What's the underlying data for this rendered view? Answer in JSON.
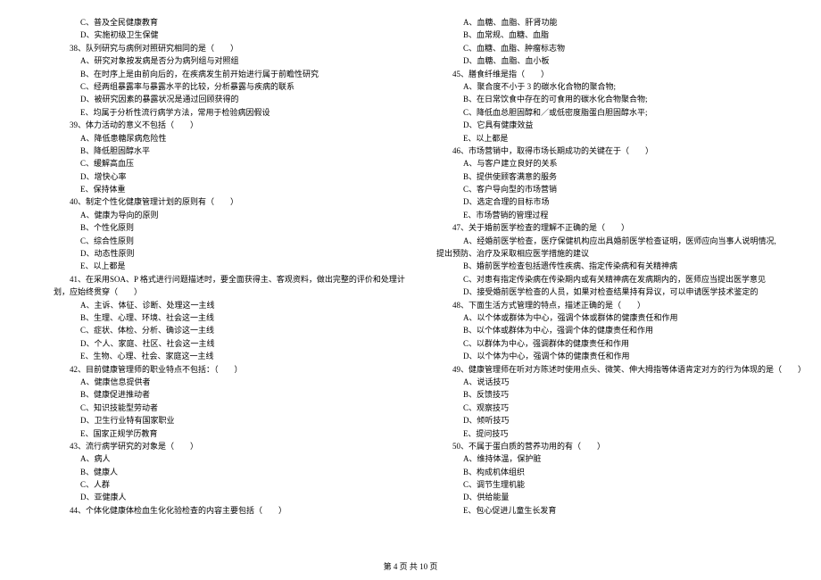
{
  "left": [
    {
      "cls": "indent1",
      "t": "C、普及全民健康教育"
    },
    {
      "cls": "indent1",
      "t": "D、实施初级卫生保健"
    },
    {
      "cls": "q",
      "t": "38、队列研究与病例对照研究相同的是（　　）"
    },
    {
      "cls": "indent1",
      "t": "A、研究对象按发病是否分为病列组与对照组"
    },
    {
      "cls": "indent1",
      "t": "B、在时序上是由前向后的，在疾病发生前开始进行属于前瞻性研究"
    },
    {
      "cls": "indent1",
      "t": "C、经两组暴露率与暴露水平的比较，分析暴露与疾病的联系"
    },
    {
      "cls": "indent1",
      "t": "D、被研究因素的暴露状况是通过回顾获得的"
    },
    {
      "cls": "indent1",
      "t": "E、均属于分析性流行病学方法，常用于检验病因假设"
    },
    {
      "cls": "q",
      "t": "39、体力活动的意义不包括（　　）"
    },
    {
      "cls": "indent1",
      "t": "A、降低患糖尿病危险性"
    },
    {
      "cls": "indent1",
      "t": "B、降低胆固醇水平"
    },
    {
      "cls": "indent1",
      "t": "C、缓解高血压"
    },
    {
      "cls": "indent1",
      "t": "D、增快心率"
    },
    {
      "cls": "indent1",
      "t": "E、保持体重"
    },
    {
      "cls": "q",
      "t": "40、制定个性化健康管理计划的原则有（　　）"
    },
    {
      "cls": "indent1",
      "t": "A、健康为导向的原则"
    },
    {
      "cls": "indent1",
      "t": "B、个性化原则"
    },
    {
      "cls": "indent1",
      "t": "C、综合性原则"
    },
    {
      "cls": "indent1",
      "t": "D、动态性原则"
    },
    {
      "cls": "indent1",
      "t": "E、以上都是"
    },
    {
      "cls": "q",
      "t": "41、在采用SOA、P 格式进行问题描述时，要全面获得主、客观资料，做出完整的评价和处理计"
    },
    {
      "cls": "long",
      "t": "划，应始终贯穿（　　）"
    },
    {
      "cls": "indent1",
      "t": "A、主诉、体征、诊断、处理这一主线"
    },
    {
      "cls": "indent1",
      "t": "B、生理、心理、环境、社会这一主线"
    },
    {
      "cls": "indent1",
      "t": "C、症状、体检、分析、确诊这一主线"
    },
    {
      "cls": "indent1",
      "t": "D、个人、家庭、社区、社会这一主线"
    },
    {
      "cls": "indent1",
      "t": "E、生物、心理、社会、家庭这一主线"
    },
    {
      "cls": "q",
      "t": "42、目前健康管理师的职业特点不包括：（　　）"
    },
    {
      "cls": "indent1",
      "t": "A、健康信息提供者"
    },
    {
      "cls": "indent1",
      "t": "B、健康促进推动者"
    },
    {
      "cls": "indent1",
      "t": "C、知识技能型劳动者"
    },
    {
      "cls": "indent1",
      "t": "D、卫生行业特有国家职业"
    },
    {
      "cls": "indent1",
      "t": "E、国家正规学历教育"
    },
    {
      "cls": "q",
      "t": "43、流行病学研究的对象是（　　）"
    },
    {
      "cls": "indent1",
      "t": "A、病人"
    },
    {
      "cls": "indent1",
      "t": "B、健康人"
    },
    {
      "cls": "indent1",
      "t": "C、人群"
    },
    {
      "cls": "indent1",
      "t": "D、亚健康人"
    },
    {
      "cls": "q",
      "t": "44、个体化健康体检血生化化验检查的内容主要包括（　　）"
    }
  ],
  "right": [
    {
      "cls": "indent1",
      "t": "A、血糖、血脂、肝肾功能"
    },
    {
      "cls": "indent1",
      "t": "B、血常规、血糖、血脂"
    },
    {
      "cls": "indent1",
      "t": "C、血糖、血脂、肿瘤标志物"
    },
    {
      "cls": "indent1",
      "t": "D、血糖、血脂、血小板"
    },
    {
      "cls": "q",
      "t": "45、膳食纤维是指（　　）"
    },
    {
      "cls": "indent1",
      "t": "A、聚合度不小于 3 的碳水化合物的聚合物;"
    },
    {
      "cls": "indent1",
      "t": "B、在日常饮食中存在的可食用的碳水化合物聚合物;"
    },
    {
      "cls": "indent1",
      "t": "C、降低血总胆固醇和／或低密度脂蛋白胆固醇水平;"
    },
    {
      "cls": "indent1",
      "t": "D、它具有健康效益"
    },
    {
      "cls": "indent1",
      "t": "E、以上都是"
    },
    {
      "cls": "q",
      "t": "46、市场营销中，取得市场长期成功的关键在于（　　）"
    },
    {
      "cls": "indent1",
      "t": "A、与客户建立良好的关系"
    },
    {
      "cls": "indent1",
      "t": "B、提供使顾客满意的服务"
    },
    {
      "cls": "indent1",
      "t": "C、客户导向型的市场营销"
    },
    {
      "cls": "indent1",
      "t": "D、选定合理的目标市场"
    },
    {
      "cls": "indent1",
      "t": "E、市场营销的管理过程"
    },
    {
      "cls": "q",
      "t": "47、关于婚前医学检查的理解不正确的是（　　）"
    },
    {
      "cls": "indent1",
      "t": "A、经婚前医学检查，医疗保健机构应出具婚前医学检查证明，医师应向当事人说明情况,"
    },
    {
      "cls": "long",
      "t": "提出预防、治疗及采取相应医学措施的建议"
    },
    {
      "cls": "indent1",
      "t": "B、婚前医学检查包括遗传性疾病、指定传染病和有关精神病"
    },
    {
      "cls": "indent1",
      "t": "C、对患有指定传染病在传染期内或有关精神病在发病期内的，医师应当提出医学意见"
    },
    {
      "cls": "indent1",
      "t": "D、接受婚前医学检查的人员，如果对检查结果持有异议，可以申请医学技术鉴定的"
    },
    {
      "cls": "q",
      "t": "48、下面生活方式管理的特点，描述正确的是（　　）"
    },
    {
      "cls": "indent1",
      "t": "A、以个体或群体为中心，强调个体或群体的健康责任和作用"
    },
    {
      "cls": "indent1",
      "t": "B、以个体或群体为中心，强调个体的健康责任和作用"
    },
    {
      "cls": "indent1",
      "t": "C、以群体为中心，强调群体的健康责任和作用"
    },
    {
      "cls": "indent1",
      "t": "D、以个体为中心，强调个体的健康责任和作用"
    },
    {
      "cls": "q",
      "t": "49、健康管理师在听对方陈述时使用点头、微笑、伸大拇指等体语肯定对方的行为体现的是（　　）"
    },
    {
      "cls": "indent1",
      "t": "A、说话技巧"
    },
    {
      "cls": "indent1",
      "t": "B、反馈技巧"
    },
    {
      "cls": "indent1",
      "t": "C、观察技巧"
    },
    {
      "cls": "indent1",
      "t": "D、倾听技巧"
    },
    {
      "cls": "indent1",
      "t": "E、提问技巧"
    },
    {
      "cls": "q",
      "t": "50、不属于蛋白质的营养功用的有（　　）"
    },
    {
      "cls": "indent1",
      "t": "A、维持体温，保护脏"
    },
    {
      "cls": "indent1",
      "t": "B、构成机体组织"
    },
    {
      "cls": "indent1",
      "t": "C、调节生理机能"
    },
    {
      "cls": "indent1",
      "t": "D、供给能量"
    },
    {
      "cls": "indent1",
      "t": "E、包心促进儿童生长发育"
    }
  ],
  "footer": "第 4 页 共 10 页"
}
